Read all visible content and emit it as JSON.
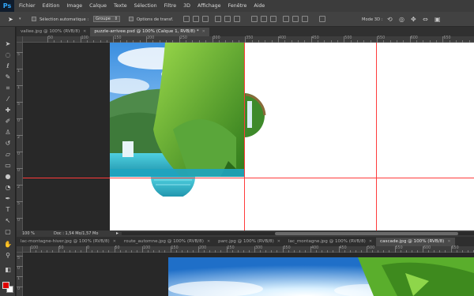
{
  "menubar": {
    "logo": "Ps",
    "items": [
      "Fichier",
      "Edition",
      "Image",
      "Calque",
      "Texte",
      "Sélection",
      "Filtre",
      "3D",
      "Affichage",
      "Fenêtre",
      "Aide"
    ]
  },
  "options": {
    "auto_select_label": "Sélection automatique :",
    "group_value": "Groupe",
    "transform_label": "Options de transf.",
    "mode3d_label": "Mode 3D :"
  },
  "tabs_top": [
    {
      "label": "vallee.jpg @ 100% (RVB/8)",
      "active": false
    },
    {
      "label": "puzzle-arrivee.psd @ 100% (Calque 1, RVB/8) *",
      "active": true
    }
  ],
  "tabs_bottom": [
    {
      "label": "lac-montagne-hiver.jpg @ 100% (RVB/8)",
      "active": false
    },
    {
      "label": "route_automne.jpg @ 100% (RVB/8)",
      "active": false
    },
    {
      "label": "parc.jpg @ 100% (RVB/8)",
      "active": false
    },
    {
      "label": "lac_montagne.jpg @ 100% (RVB/8)",
      "active": false
    },
    {
      "label": "cascade.jpg @ 100% (RVB/8)",
      "active": true
    }
  ],
  "status": {
    "zoom": "100 %",
    "doc": "Doc : 1,54 Mo/1,57 Mo",
    "arrow": "▸"
  },
  "ruler_top": [
    "50",
    "100",
    "150",
    "200",
    "250",
    "300",
    "350",
    "400",
    "450",
    "500",
    "550",
    "600",
    "650",
    "700"
  ],
  "ruler_bottom": [
    "100",
    "50",
    "0",
    "50",
    "100",
    "150",
    "200",
    "250",
    "300",
    "350",
    "400",
    "450",
    "500",
    "550",
    "600",
    "650"
  ],
  "ruler_left": [
    "5",
    "1",
    "1",
    "5",
    "0",
    "2",
    "0",
    "0",
    "2",
    "5",
    "0"
  ],
  "ruler_left2": [
    "5",
    "0",
    "1",
    "0"
  ],
  "colors": {
    "guide": "#ff3b3b",
    "canvas": "#ffffff",
    "foreground": "#e00000",
    "background": "#ffffff"
  },
  "tools": [
    "move-icon",
    "marquee-icon",
    "lasso-icon",
    "quick-select-icon",
    "crop-icon",
    "eyedropper-icon",
    "healing-icon",
    "brush-icon",
    "stamp-icon",
    "history-brush-icon",
    "eraser-icon",
    "gradient-icon",
    "blur-icon",
    "dodge-icon",
    "pen-icon",
    "type-icon",
    "path-select-icon",
    "shape-icon",
    "hand-icon",
    "zoom-icon"
  ]
}
